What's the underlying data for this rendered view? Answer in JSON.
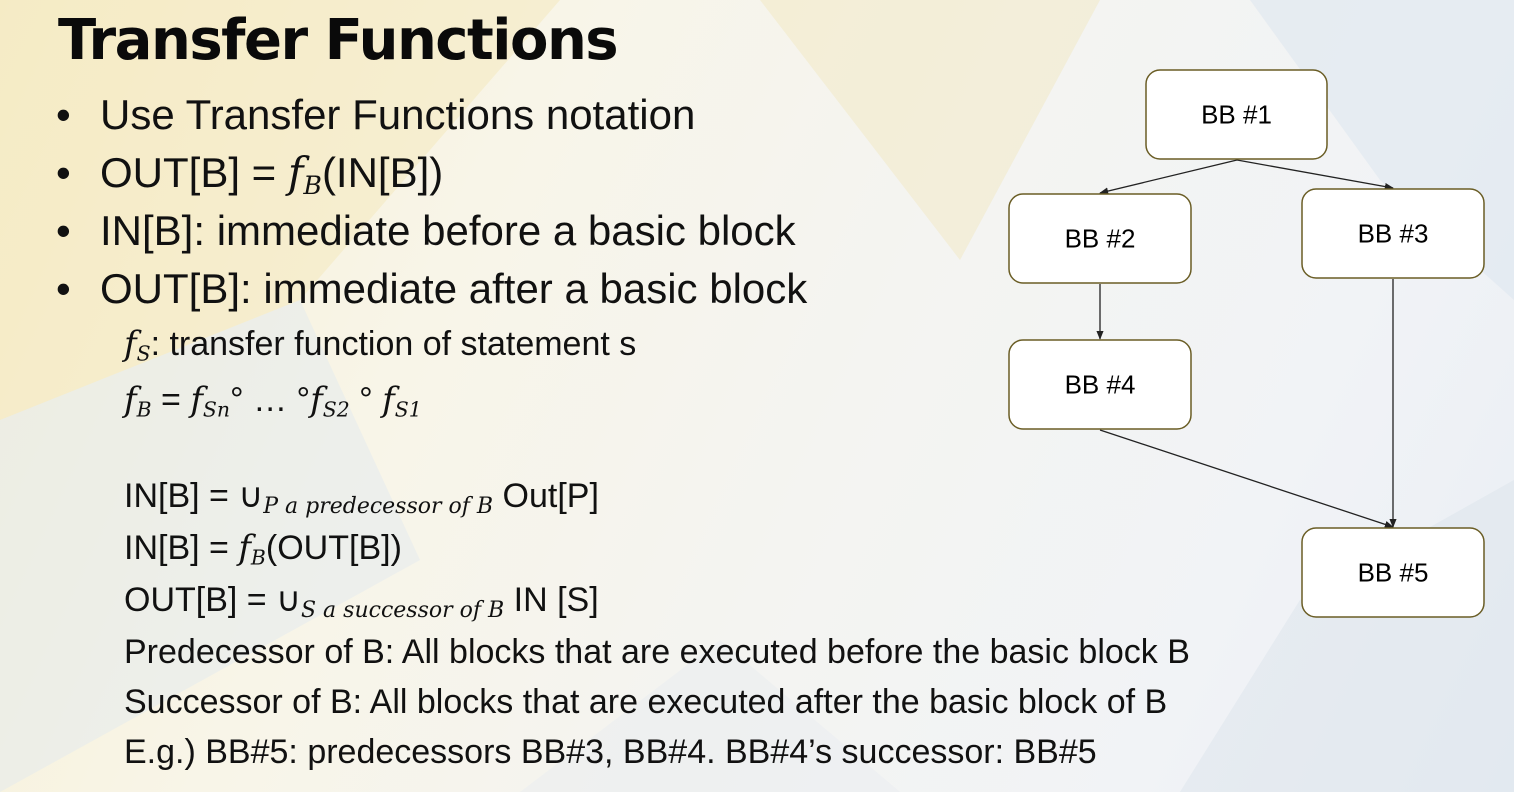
{
  "title": "Transfer Functions",
  "bullets": [
    "Use Transfer Functions notation",
    {
      "pre": "OUT[B] = ",
      "f": "f",
      "sub": "B",
      "post": "(IN[B])"
    },
    "IN[B]: immediate before a basic block",
    "OUT[B]: immediate after a basic block"
  ],
  "bullet_marker": "•",
  "details": {
    "fs_symbol": "f",
    "fs_sub": "S",
    "fs_text": ": transfer function of statement s",
    "fb_line": {
      "lhs_f": "f",
      "lhs_sub": "B",
      "eq": " = ",
      "t1_f": "f",
      "t1_sub": "Sn",
      "ring1": "° … °",
      "t2_f": "f",
      "t2_sub": "S2",
      "ring2": " ° ",
      "t3_f": "f",
      "t3_sub": "S1"
    },
    "in_union": {
      "pre": "IN[B] = ∪",
      "sub": "P a predecessor of B",
      "post": " Out[P]"
    },
    "in_fb": {
      "pre": "IN[B] = ",
      "f": "f",
      "sub": "B",
      "post": "(OUT[B])"
    },
    "out_union": {
      "pre": "OUT[B] = ∪",
      "sub": "S a successor of B",
      "post": "  IN [S]"
    },
    "predecessor_def": "Predecessor of B: All blocks that are executed before the basic block B",
    "successor_def": "Successor of B: All blocks that are executed after the basic block of B",
    "example": "E.g.) BB#5: predecessors BB#3, BB#4.  BB#4’s successor: BB#5"
  },
  "diagram": {
    "nodes": [
      {
        "id": "bb1",
        "label": "BB #1"
      },
      {
        "id": "bb2",
        "label": "BB #2"
      },
      {
        "id": "bb3",
        "label": "BB #3"
      },
      {
        "id": "bb4",
        "label": "BB #4"
      },
      {
        "id": "bb5",
        "label": "BB #5"
      }
    ],
    "edges": [
      {
        "from": "bb1",
        "to": "bb2"
      },
      {
        "from": "bb1",
        "to": "bb3"
      },
      {
        "from": "bb2",
        "to": "bb4"
      },
      {
        "from": "bb3",
        "to": "bb5"
      },
      {
        "from": "bb4",
        "to": "bb5"
      }
    ],
    "node_border_color": "#6a5d25"
  }
}
